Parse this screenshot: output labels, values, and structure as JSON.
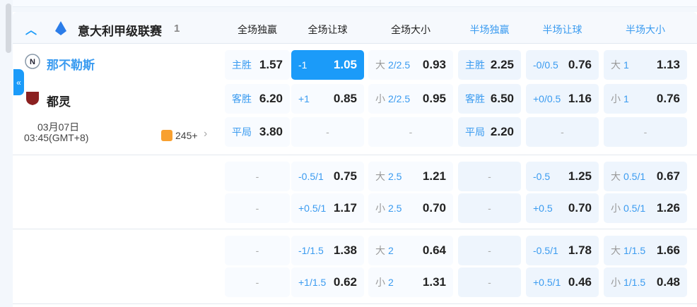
{
  "league": {
    "name": "意大利甲级联赛",
    "count": "1"
  },
  "columns": [
    "全场独赢",
    "全场让球",
    "全场大小",
    "半场独赢",
    "半场让球",
    "半场大小"
  ],
  "match": {
    "home": "那不勒斯",
    "away": "都灵",
    "date": "03月07日",
    "time": "03:45(GMT+8)",
    "markets": "245+"
  },
  "rows": [
    [
      {
        "l": "主胜",
        "v": "1.57"
      },
      {
        "l": "-1",
        "v": "1.05",
        "sel": true
      },
      {
        "p": "大",
        "l": "2/2.5",
        "v": "0.93"
      },
      {
        "l": "主胜",
        "v": "2.25"
      },
      {
        "l": "-0/0.5",
        "v": "0.76"
      },
      {
        "p": "大",
        "l": "1",
        "v": "1.13"
      }
    ],
    [
      {
        "l": "客胜",
        "v": "6.20"
      },
      {
        "l": "+1",
        "v": "0.85"
      },
      {
        "p": "小",
        "l": "2/2.5",
        "v": "0.95"
      },
      {
        "l": "客胜",
        "v": "6.50"
      },
      {
        "l": "+0/0.5",
        "v": "1.16"
      },
      {
        "p": "小",
        "l": "1",
        "v": "0.76"
      }
    ],
    [
      {
        "l": "平局",
        "v": "3.80"
      },
      {
        "d": "-"
      },
      {
        "d": "-"
      },
      {
        "l": "平局",
        "v": "2.20"
      },
      {
        "d": "-"
      },
      {
        "d": "-"
      }
    ],
    [
      {
        "d": "-"
      },
      {
        "l": "-0.5/1",
        "v": "0.75"
      },
      {
        "p": "大",
        "l": "2.5",
        "v": "1.21"
      },
      {
        "d": "-"
      },
      {
        "l": "-0.5",
        "v": "1.25"
      },
      {
        "p": "大",
        "l": "0.5/1",
        "v": "0.67"
      }
    ],
    [
      {
        "d": "-"
      },
      {
        "l": "+0.5/1",
        "v": "1.17"
      },
      {
        "p": "小",
        "l": "2.5",
        "v": "0.70"
      },
      {
        "d": "-"
      },
      {
        "l": "+0.5",
        "v": "0.70"
      },
      {
        "p": "小",
        "l": "0.5/1",
        "v": "1.26"
      }
    ],
    [
      {
        "d": "-"
      },
      {
        "l": "-1/1.5",
        "v": "1.38"
      },
      {
        "p": "大",
        "l": "2",
        "v": "0.64"
      },
      {
        "d": "-"
      },
      {
        "l": "-0.5/1",
        "v": "1.78"
      },
      {
        "p": "大",
        "l": "1/1.5",
        "v": "1.66"
      }
    ],
    [
      {
        "d": "-"
      },
      {
        "l": "+1/1.5",
        "v": "0.62"
      },
      {
        "p": "小",
        "l": "2",
        "v": "1.31"
      },
      {
        "d": "-"
      },
      {
        "l": "+0.5/1",
        "v": "0.46"
      },
      {
        "p": "小",
        "l": "1/1.5",
        "v": "0.48"
      }
    ]
  ],
  "colors": {
    "accent": "#1b9bf9",
    "label": "#3a9bf0"
  }
}
